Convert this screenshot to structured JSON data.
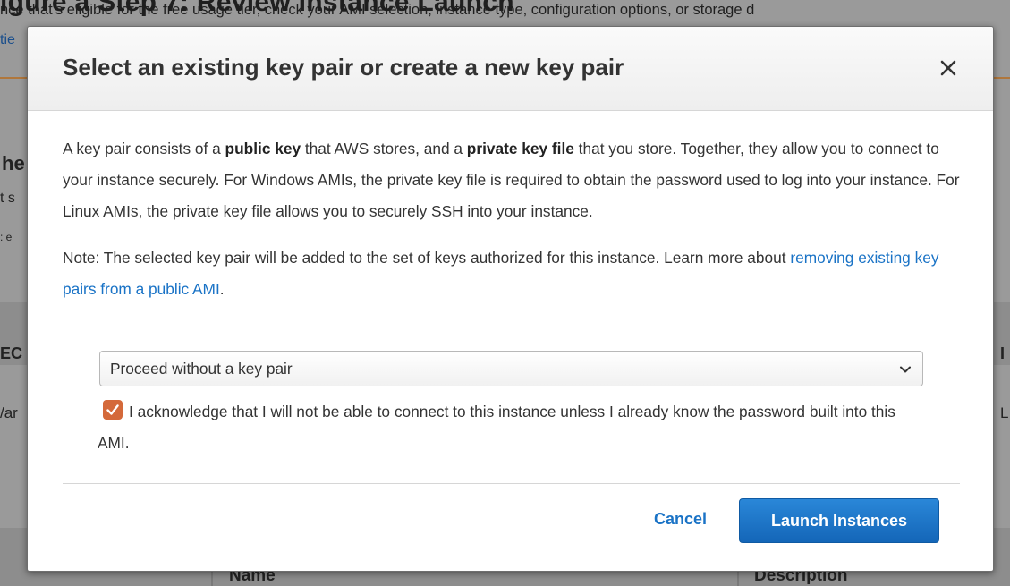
{
  "background": {
    "title_fragment": "igure a                                       Step 7: Review Instance Launch",
    "line1": "nce that's eligible for the free usage tier, check your AMI selection, instance type, configuration options, or storage d",
    "link_fragment": "tie",
    "left_fragments": [
      "he",
      "t s",
      ": e",
      "EC",
      "/ar"
    ],
    "right_fragments": [
      "I",
      "L"
    ],
    "bottom_name": "Name",
    "bottom_description": "Description"
  },
  "modal": {
    "title": "Select an existing key pair or create a new key pair",
    "paragraph": {
      "p1": "A key pair consists of a ",
      "b1": "public key",
      "p2": " that AWS stores, and a ",
      "b2": "private key file",
      "p3": " that you store. Together, they allow you to connect to your instance securely. For Windows AMIs, the private key file is required to obtain the password used to log into your instance. For Linux AMIs, the private key file allows you to securely SSH into your instance."
    },
    "note": {
      "text": "Note: The selected key pair will be added to the set of keys authorized for this instance. Learn more about ",
      "link": "removing existing key pairs from a public AMI",
      "end": "."
    },
    "key_pair_select": {
      "value": "Proceed without a key pair"
    },
    "acknowledge": {
      "checked": true,
      "text": "I acknowledge that I will not be able to connect to this instance unless I already know the password built into this AMI."
    },
    "buttons": {
      "cancel": "Cancel",
      "launch": "Launch Instances"
    }
  },
  "colors": {
    "link": "#1a73c6",
    "primary_button": "#1a73c6",
    "checkbox": "#d4693a",
    "overlay": "#9a9a9a"
  }
}
